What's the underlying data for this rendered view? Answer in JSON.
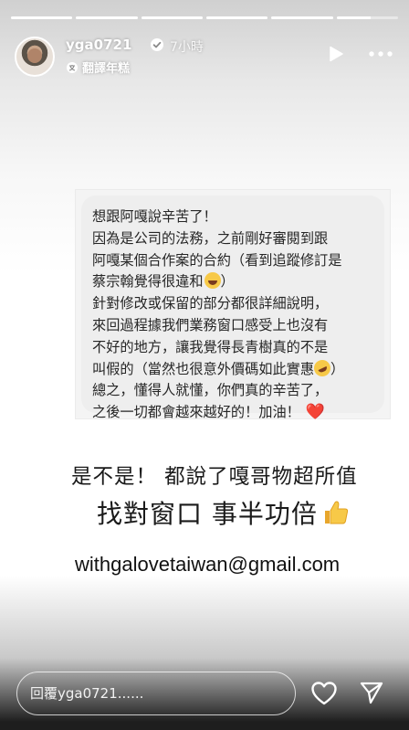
{
  "story": {
    "progress_segments": [
      1,
      1,
      1,
      1,
      1,
      0.55
    ]
  },
  "header": {
    "username": "yga0721",
    "time_ago": "7小時",
    "translate_label": "翻譯年糕"
  },
  "message": {
    "lines": [
      "想跟阿嘎說辛苦了！",
      "因為是公司的法務，之前剛好審閱到跟",
      "阿嘎某個合作案的合約（看到追蹤修訂是",
      "蔡宗翰覺得很違和",
      "）",
      "針對修改或保留的部分都很詳細說明，",
      "來回過程據我們業務窗口感受上也沒有",
      "不好的地方，讓我覺得長青樹真的不是",
      "叫假的（當然也很意外價碼如此實惠",
      "）",
      "總之，懂得人就懂，你們真的辛苦了，",
      "之後一切都會越來越好的！加油！",
      "❤️"
    ]
  },
  "captions": {
    "line1": "是不是！ 都說了嘎哥物超所值",
    "line2": "找對窗口 事半功倍",
    "email": "withgalovetaiwan@gmail.com"
  },
  "reply": {
    "placeholder": "回覆yga0721......"
  }
}
